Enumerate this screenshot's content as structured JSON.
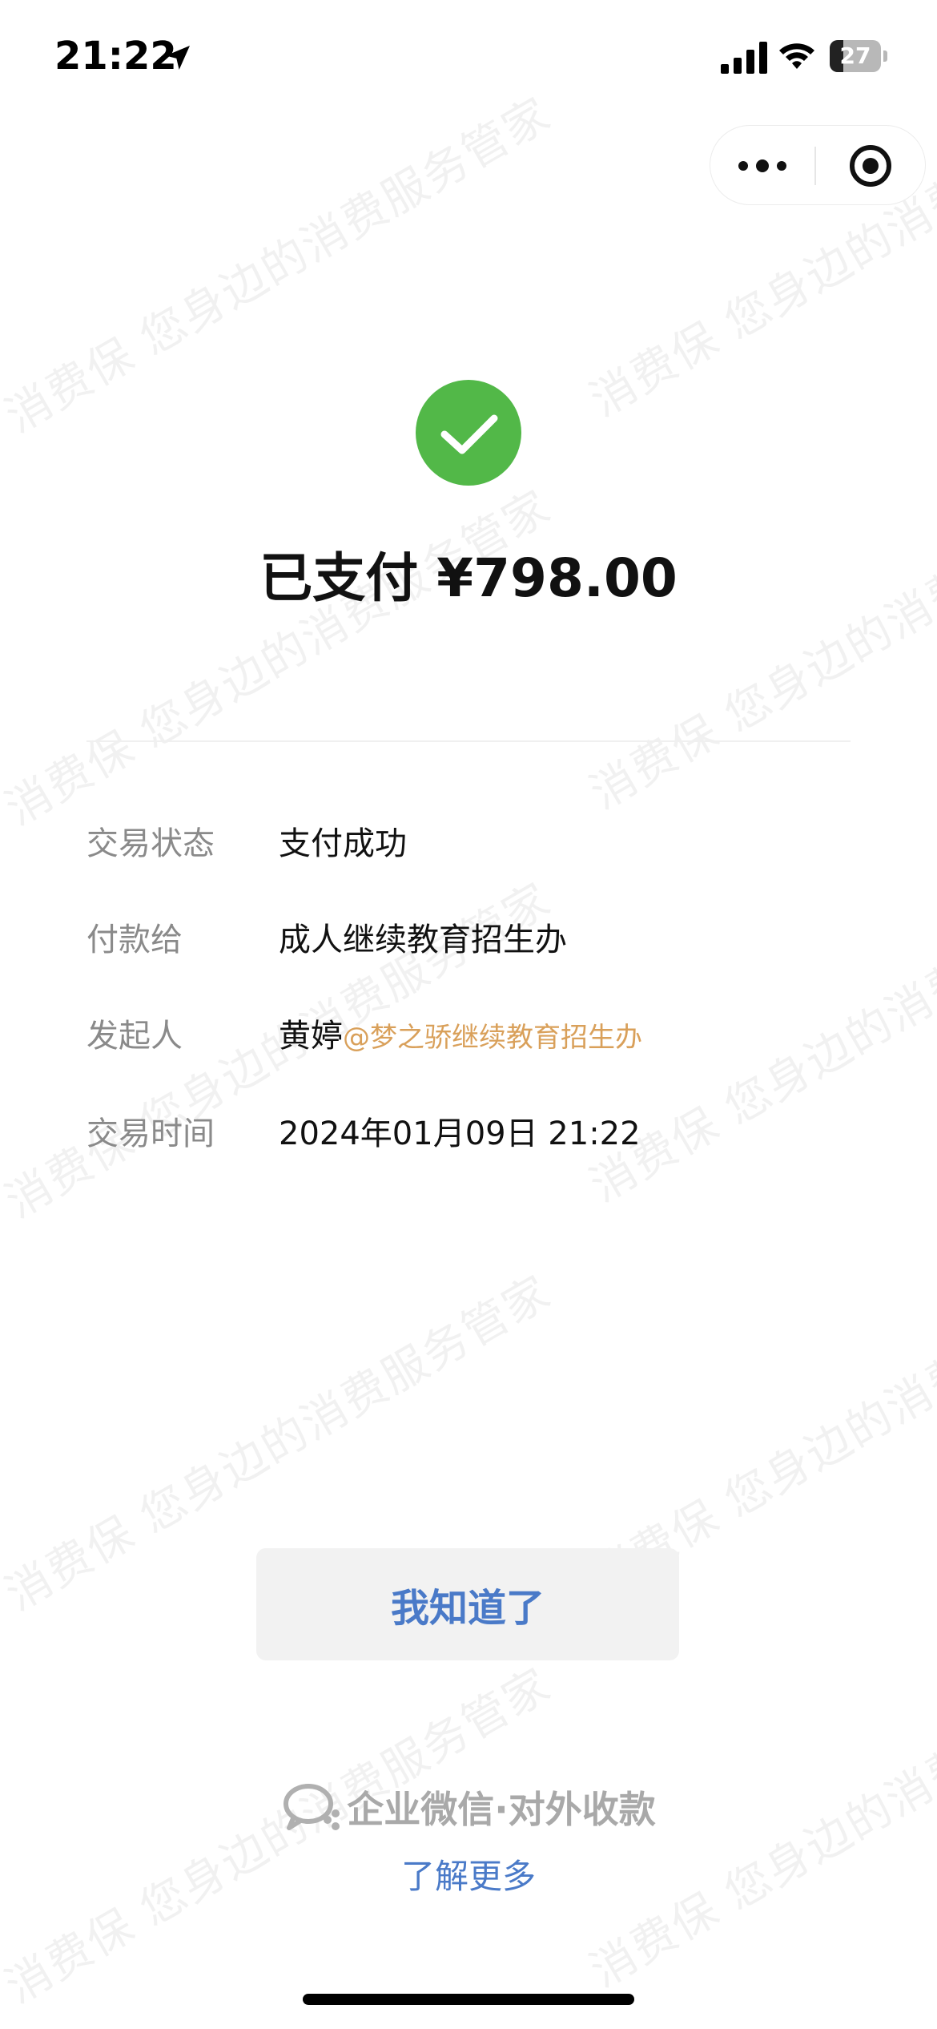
{
  "status_bar": {
    "time": "21:22",
    "battery_level": "27",
    "battery_fraction": 0.27
  },
  "watermark": {
    "text": "消费保 您身边的消费服务管家"
  },
  "payment": {
    "title": "已支付 ¥798.00",
    "status_color": "#52b848"
  },
  "details": [
    {
      "label": "交易状态",
      "value": "支付成功"
    },
    {
      "label": "付款给",
      "value": "成人继续教育招生办"
    },
    {
      "label": "发起人",
      "value": "黄婷",
      "value_extra": "@梦之骄继续教育招生办"
    },
    {
      "label": "交易时间",
      "value": "2024年01月09日 21:22"
    }
  ],
  "button": {
    "label": "我知道了"
  },
  "footer": {
    "brand": "企业微信·对外收款",
    "link": "了解更多"
  },
  "colors": {
    "accent": "#4a7ac8",
    "success": "#52b848",
    "org_highlight": "#d9a05a",
    "label_gray": "#8a8a8a"
  },
  "icons": [
    "location-arrow-icon",
    "cellular-signal-icon",
    "wifi-icon",
    "battery-icon",
    "more-dots-icon",
    "close-target-icon",
    "check-circle-icon",
    "wecom-logo-icon"
  ]
}
